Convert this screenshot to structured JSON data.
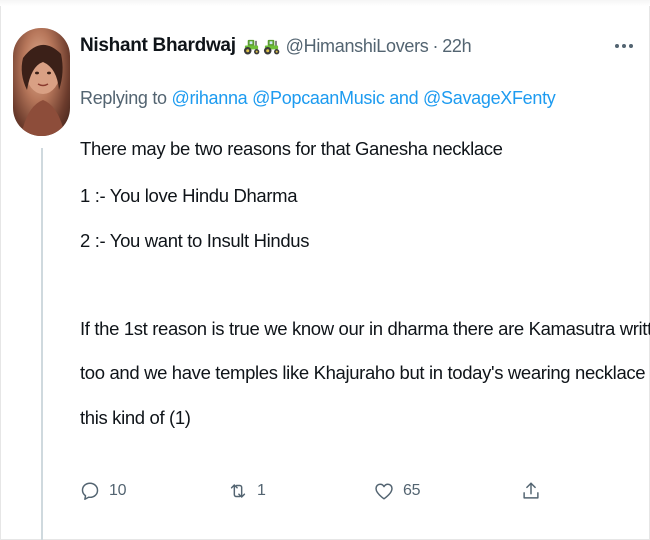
{
  "tweet": {
    "author_name": "Nishant Bhardwaj",
    "author_emoji_icons": [
      "tractor-icon",
      "tractor-icon"
    ],
    "handle": "@HimanshiLovers",
    "separator": "·",
    "time": "22h",
    "replying_prefix": "Replying to ",
    "reply_mentions": "@rihanna @PopcaanMusic and @SavageXFenty",
    "lines": [
      "There may be two reasons for that Ganesha necklace",
      "1 :- You love Hindu Dharma",
      "2 :- You want to Insult Hindus",
      "If the 1st reason is true we know our in dharma there are Kamasutra written",
      "too and we have temples like Khajuraho but in today's wearing necklace in",
      "this kind of (1)"
    ]
  },
  "actions": {
    "reply_count": "10",
    "retweet_count": "1",
    "like_count": "65",
    "icons": [
      "reply-icon",
      "retweet-icon",
      "like-icon",
      "share-icon"
    ]
  },
  "colors": {
    "text": "#0f1419",
    "secondary": "#536471",
    "link": "#1d9bf0",
    "thread_line": "#cfd9de"
  }
}
